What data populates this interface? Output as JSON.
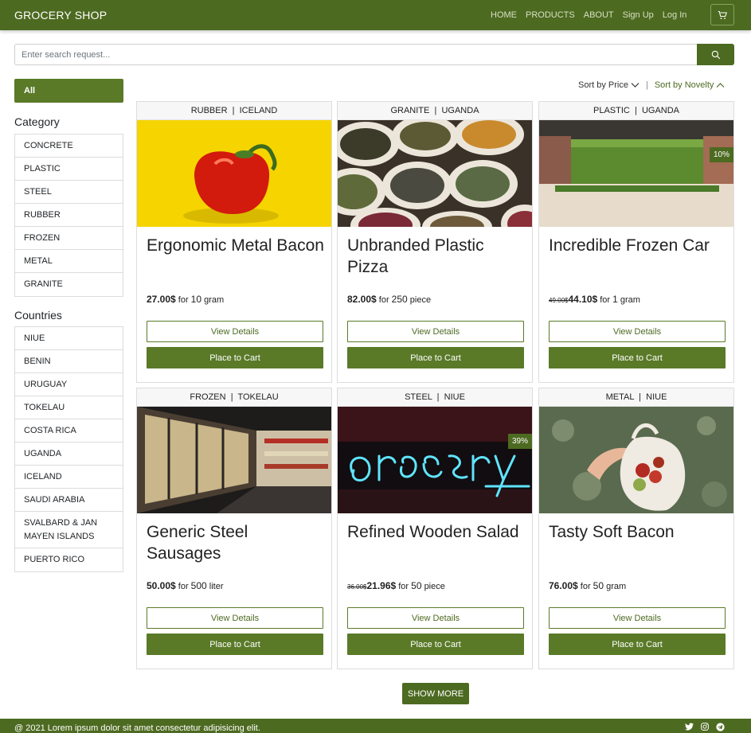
{
  "navbar": {
    "brand": "GROCERY SHOP",
    "links": [
      "HOME",
      "PRODUCTS",
      "ABOUT",
      "Sign Up",
      "Log In"
    ]
  },
  "search": {
    "placeholder": "Enter search request..."
  },
  "sidebar": {
    "all_label": "All",
    "category_heading": "Category",
    "categories": [
      "CONCRETE",
      "PLASTIC",
      "STEEL",
      "RUBBER",
      "FROZEN",
      "METAL",
      "GRANITE"
    ],
    "countries_heading": "Countries",
    "countries": [
      "NIUE",
      "BENIN",
      "URUGUAY",
      "TOKELAU",
      "COSTA RICA",
      "UGANDA",
      "ICELAND",
      "SAUDI ARABIA",
      "SVALBARD & JAN MAYEN ISLANDS",
      "PUERTO RICO"
    ]
  },
  "sort": {
    "price_label": "Sort by Price",
    "novelty_label": "Sort by Novelty",
    "separator": "|"
  },
  "buttons": {
    "details": "View Details",
    "cart": "Place to Cart",
    "show_more": "SHOW MORE"
  },
  "products": [
    {
      "material": "RUBBER",
      "country": "ICELAND",
      "title": "Ergonomic Metal Bacon",
      "old_price": "",
      "price": "27.00$",
      "qty": "10",
      "unit": "gram",
      "discount": "",
      "image": "red-pepper"
    },
    {
      "material": "GRANITE",
      "country": "UGANDA",
      "title": "Unbranded Plastic Pizza",
      "old_price": "",
      "price": "82.00$",
      "qty": "250",
      "unit": "piece",
      "discount": "",
      "image": "spice-bags"
    },
    {
      "material": "PLASTIC",
      "country": "UGANDA",
      "title": "Incredible Frozen Car",
      "old_price": "49.00$",
      "price": "44.10$",
      "qty": "1",
      "unit": "gram",
      "discount": "10%",
      "image": "store-aisle"
    },
    {
      "material": "FROZEN",
      "country": "TOKELAU",
      "title": "Generic Steel Sausages",
      "old_price": "",
      "price": "50.00$",
      "qty": "500",
      "unit": "liter",
      "discount": "",
      "image": "freezer-aisle"
    },
    {
      "material": "STEEL",
      "country": "NIUE",
      "title": "Refined Wooden Salad",
      "old_price": "36.00$",
      "price": "21.96$",
      "qty": "50",
      "unit": "piece",
      "discount": "39%",
      "image": "neon-sign"
    },
    {
      "material": "METAL",
      "country": "NIUE",
      "title": "Tasty Soft Bacon",
      "old_price": "",
      "price": "76.00$",
      "qty": "50",
      "unit": "gram",
      "discount": "",
      "image": "produce-bag"
    }
  ],
  "price_for": "for",
  "footer": {
    "text": "@ 2021 Lorem ipsum dolor sit amet consectetur adipisicing elit.",
    "icons": [
      "twitter-icon",
      "instagram-icon",
      "telegram-icon"
    ]
  },
  "colors": {
    "primary": "#4d6a21",
    "button": "#5a7a28"
  }
}
